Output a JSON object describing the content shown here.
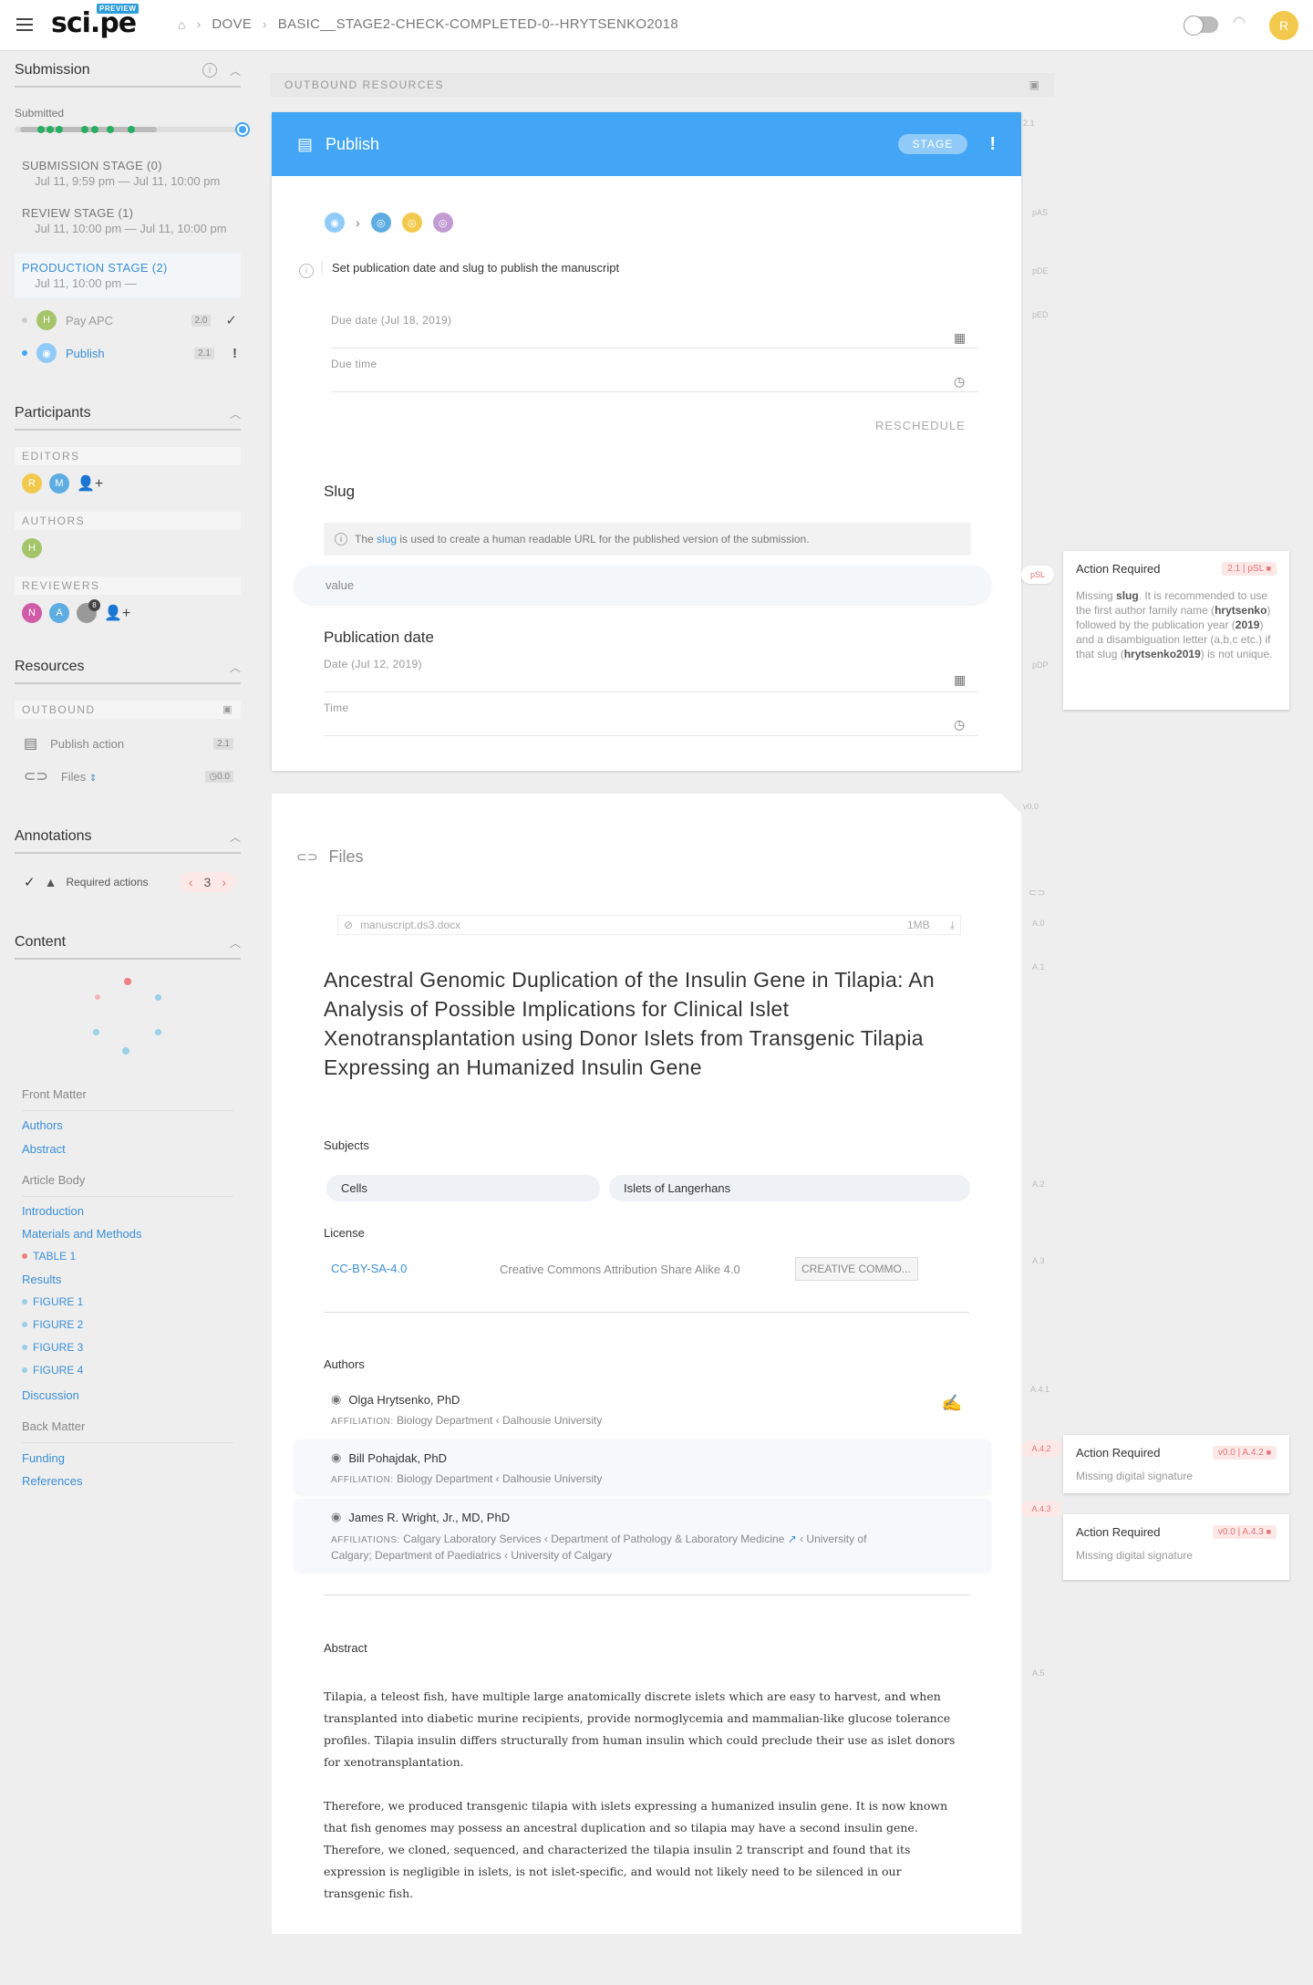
{
  "header": {
    "logo": "sci.pe",
    "badge": "PREVIEW",
    "crumb1": "DOVE",
    "crumb2": "BASIC__STAGE2-CHECK-COMPLETED-0--HRYTSENKO2018",
    "user_initial": "R"
  },
  "submission": {
    "title": "Submission",
    "status": "Submitted",
    "stages": [
      {
        "label": "SUBMISSION STAGE (0)",
        "date": "Jul 11, 9:59 pm  —  Jul 11, 10:00 pm"
      },
      {
        "label": "REVIEW STAGE (1)",
        "date": "Jul 11, 10:00 pm  —  Jul 11, 10:00 pm"
      },
      {
        "label": "PRODUCTION STAGE (2)",
        "date": "Jul 11, 10:00 pm  —"
      }
    ],
    "actions": [
      {
        "initial": "H",
        "label": "Pay APC",
        "version": "2.0",
        "mark": "✓"
      },
      {
        "initial": "",
        "label": "Publish",
        "version": "2.1",
        "mark": "!"
      }
    ]
  },
  "participants": {
    "title": "Participants",
    "editors_label": "EDITORS",
    "editors": [
      "R",
      "M"
    ],
    "authors_label": "AUTHORS",
    "authors": [
      "H"
    ],
    "reviewers_label": "REVIEWERS",
    "reviewers": [
      "N",
      "A"
    ],
    "reviewer_extra": "8"
  },
  "resources": {
    "title": "Resources",
    "outbound_label": "OUTBOUND",
    "items": [
      {
        "label": "Publish action",
        "version": "2.1"
      },
      {
        "label": "Files",
        "version": "0.0"
      }
    ]
  },
  "annotations": {
    "title": "Annotations",
    "label": "Required actions",
    "count": "3"
  },
  "content": {
    "title": "Content",
    "front_matter": "Front Matter",
    "front_items": [
      "Authors",
      "Abstract"
    ],
    "article_body": "Article Body",
    "body_items": [
      "Introduction",
      "Materials and Methods",
      "TABLE 1",
      "Results",
      "FIGURE 1",
      "FIGURE 2",
      "FIGURE 3",
      "FIGURE 4",
      "Discussion"
    ],
    "back_matter": "Back Matter",
    "back_items": [
      "Funding",
      "References"
    ]
  },
  "main": {
    "outbound_resources": "OUTBOUND RESOURCES",
    "publish_title": "Publish",
    "stage_badge": "STAGE",
    "exclaim": "!",
    "instruction": "Set publication date and slug to publish the manuscript",
    "due_date_label": "Due date (Jul 18, 2019)",
    "due_time_label": "Due time",
    "reschedule": "RESCHEDULE",
    "slug_title": "Slug",
    "slug_info_pre": "The",
    "slug_info_link": "slug",
    "slug_info_post": "is used to create a human readable URL for the published version of the submission.",
    "slug_placeholder": "value",
    "pubdate_title": "Publication date",
    "date_label": "Date (Jul 12, 2019)",
    "time_label": "Time"
  },
  "files": {
    "title": "Files",
    "filename": "manuscript.ds3.docx",
    "size": "1MB",
    "article_title": "Ancestral Genomic Duplication of the Insulin Gene in Tilapia: An Analysis of Possible Implications for Clinical Islet Xenotransplantation using Donor Islets from Transgenic Tilapia Expressing an Humanized Insulin Gene",
    "subjects_label": "Subjects",
    "subjects": [
      "Cells",
      "Islets of Langerhans"
    ],
    "license_label": "License",
    "license_id": "CC-BY-SA-4.0",
    "license_name": "Creative Commons Attribution Share Alike 4.0",
    "license_badge": "CREATIVE COMMO...",
    "authors_label": "Authors",
    "authors": [
      {
        "name": "Olga Hrytsenko, PhD",
        "aff_label": "AFFILIATION:",
        "aff": "Biology Department ‹ Dalhousie University"
      },
      {
        "name": "Bill Pohajdak, PhD",
        "aff_label": "AFFILIATION:",
        "aff": "Biology Department ‹ Dalhousie University"
      },
      {
        "name": "James R. Wright, Jr., MD, PhD",
        "aff_label": "AFFILIATIONS:",
        "aff": "Calgary Laboratory Services ‹ Department of Pathology & Laboratory Medicine",
        "aff2": "‹ University of",
        "aff3": "Calgary; Department of Paediatrics ‹ University of Calgary"
      }
    ],
    "abstract_label": "Abstract",
    "abstract_p1": "Tilapia, a teleost fish, have multiple large anatomically discrete islets which are easy to harvest, and when transplanted into diabetic murine recipients, provide normoglycemia and mammalian-like glucose tolerance profiles. Tilapia insulin differs structurally from human insulin which could preclude their use as islet donors for xenotransplantation.",
    "abstract_p2": "Therefore, we produced transgenic tilapia with islets expressing a humanized insulin gene. It is now known that fish genomes may possess an ancestral duplication and so tilapia may have a second insulin gene. Therefore, we cloned, sequenced, and characterized the tilapia insulin 2 transcript and found that its expression is negligible in islets, is not islet-specific, and would not likely need to be silenced in our transgenic fish."
  },
  "margin": {
    "tags": [
      "2.1",
      "pAS",
      "pDE",
      "pED",
      "pSL",
      "pDP",
      "v0.0",
      "A.0",
      "A.1",
      "A.2",
      "A.3",
      "A.4.1",
      "A.4.2",
      "A.4.3",
      "A.5"
    ]
  },
  "notes": [
    {
      "title": "Action Required",
      "ver": "2.1",
      "tag": "pSL",
      "parts": [
        "Missing",
        "slug",
        ". It is recommended to use the first author family name (",
        "hrytsenko",
        ") followed by the publication year (",
        "2019",
        ") and a disambiguation letter (a,b,c etc.) if that slug (",
        "hrytsenko2019",
        ") is not unique."
      ]
    },
    {
      "title": "Action Required",
      "ver": "v0.0",
      "tag": "A.4.2",
      "body": "Missing digital signature"
    },
    {
      "title": "Action Required",
      "ver": "v0.0",
      "tag": "A.4.3",
      "body": "Missing digital signature"
    }
  ]
}
